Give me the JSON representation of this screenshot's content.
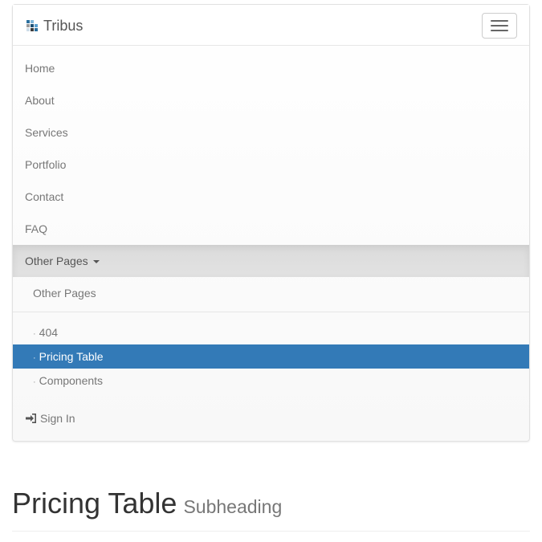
{
  "navbar": {
    "brand": "Tribus",
    "toggle_icon": "hamburger-icon",
    "items": [
      {
        "label": "Home"
      },
      {
        "label": "About"
      },
      {
        "label": "Services"
      },
      {
        "label": "Portfolio"
      },
      {
        "label": "Contact"
      },
      {
        "label": "FAQ"
      }
    ],
    "dropdown": {
      "label": "Other Pages",
      "header": "Other Pages",
      "bullet": "·",
      "items": [
        {
          "label": "404"
        },
        {
          "label": "Pricing Table",
          "active": true
        },
        {
          "label": "Components"
        }
      ]
    },
    "signin": {
      "label": "Sign In",
      "icon": "sign-in-icon"
    }
  },
  "page": {
    "title": "Pricing Table",
    "subheading": "Subheading"
  },
  "colors": {
    "active": "#337ab7",
    "navbar_bg": "#f8f8f8",
    "dropdown_open_bg": "#dcdcdc"
  }
}
